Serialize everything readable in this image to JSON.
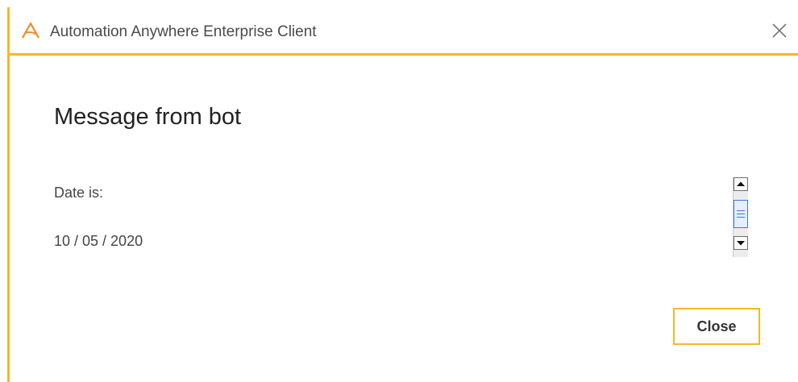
{
  "window": {
    "title": "Automation Anywhere Enterprise Client",
    "app_icon": "automation-anywhere-logo-icon",
    "close_icon": "close-icon"
  },
  "dialog": {
    "heading": "Message from bot",
    "lines": [
      "Date is:",
      "10 / 05 / 2020"
    ],
    "scrollbar": {
      "up_icon": "arrow-up-icon",
      "down_icon": "arrow-down-icon"
    },
    "close_button_label": "Close"
  },
  "colors": {
    "accent": "#f5b72a",
    "scroll_thumb_border": "#3b7bd6"
  }
}
